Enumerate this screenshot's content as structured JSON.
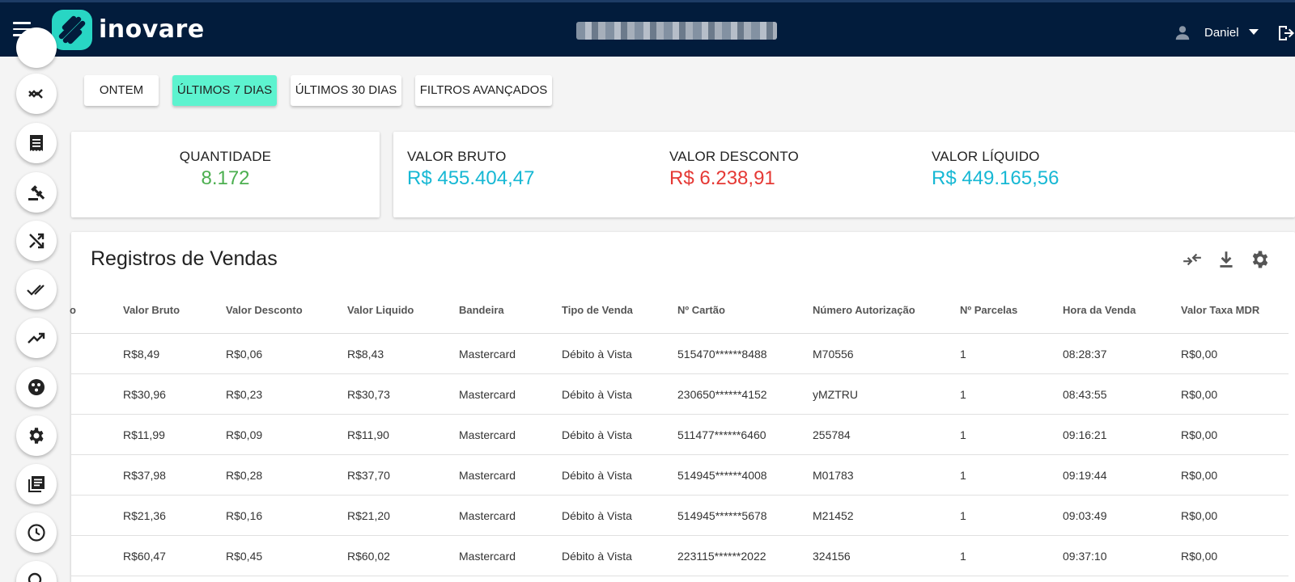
{
  "header": {
    "logo_text": "inovare",
    "user_name": "Daniel"
  },
  "colors": {
    "topbar": "#021c3c",
    "accent": "#5df3cf",
    "logo": "#28d6c4",
    "green": "#4caf50",
    "cyan": "#17b8d4",
    "red": "#e53935"
  },
  "sidebar": {
    "icons": [
      "trend-down-icon",
      "receipt-icon",
      "gavel-icon",
      "shuffle-icon",
      "double-check-icon",
      "trend-up-icon",
      "cookie-icon",
      "gear-icon",
      "library-icon",
      "clock-icon"
    ]
  },
  "filters": {
    "yesterday": "ONTEM",
    "last7": "ÚLTIMOS 7 DIAS",
    "last30": "ÚLTIMOS 30 DIAS",
    "advanced": "FILTROS AVANÇADOS"
  },
  "stats": {
    "quantity_label": "QUANTIDADE",
    "quantity_value": "8.172",
    "gross_label": "VALOR BRUTO",
    "gross_value": "R$ 455.404,47",
    "discount_label": "VALOR DESCONTO",
    "discount_value": "R$ 6.238,91",
    "net_label": "VALOR LÍQUIDO",
    "net_value": "R$ 449.165,56"
  },
  "table": {
    "title": "Registros de Vendas",
    "partial_col": "o",
    "columns": [
      "Valor Bruto",
      "Valor Desconto",
      "Valor Liquido",
      "Bandeira",
      "Tipo de Venda",
      "Nº Cartão",
      "Número Autorização",
      "Nº Parcelas",
      "Hora da Venda",
      "Valor Taxa MDR"
    ],
    "rows": [
      [
        "R$8,49",
        "R$0,06",
        "R$8,43",
        "Mastercard",
        "Débito à Vista",
        "515470******8488",
        "M70556",
        "1",
        "08:28:37",
        "R$0,00"
      ],
      [
        "R$30,96",
        "R$0,23",
        "R$30,73",
        "Mastercard",
        "Débito à Vista",
        "230650******4152",
        "yMZTRU",
        "1",
        "08:43:55",
        "R$0,00"
      ],
      [
        "R$11,99",
        "R$0,09",
        "R$11,90",
        "Mastercard",
        "Débito à Vista",
        "511477******6460",
        "255784",
        "1",
        "09:16:21",
        "R$0,00"
      ],
      [
        "R$37,98",
        "R$0,28",
        "R$37,70",
        "Mastercard",
        "Débito à Vista",
        "514945******4008",
        "M01783",
        "1",
        "09:19:44",
        "R$0,00"
      ],
      [
        "R$21,36",
        "R$0,16",
        "R$21,20",
        "Mastercard",
        "Débito à Vista",
        "514945******5678",
        "M21452",
        "1",
        "09:03:49",
        "R$0,00"
      ],
      [
        "R$60,47",
        "R$0,45",
        "R$60,02",
        "Mastercard",
        "Débito à Vista",
        "223115******2022",
        "324156",
        "1",
        "09:37:10",
        "R$0,00"
      ]
    ]
  }
}
